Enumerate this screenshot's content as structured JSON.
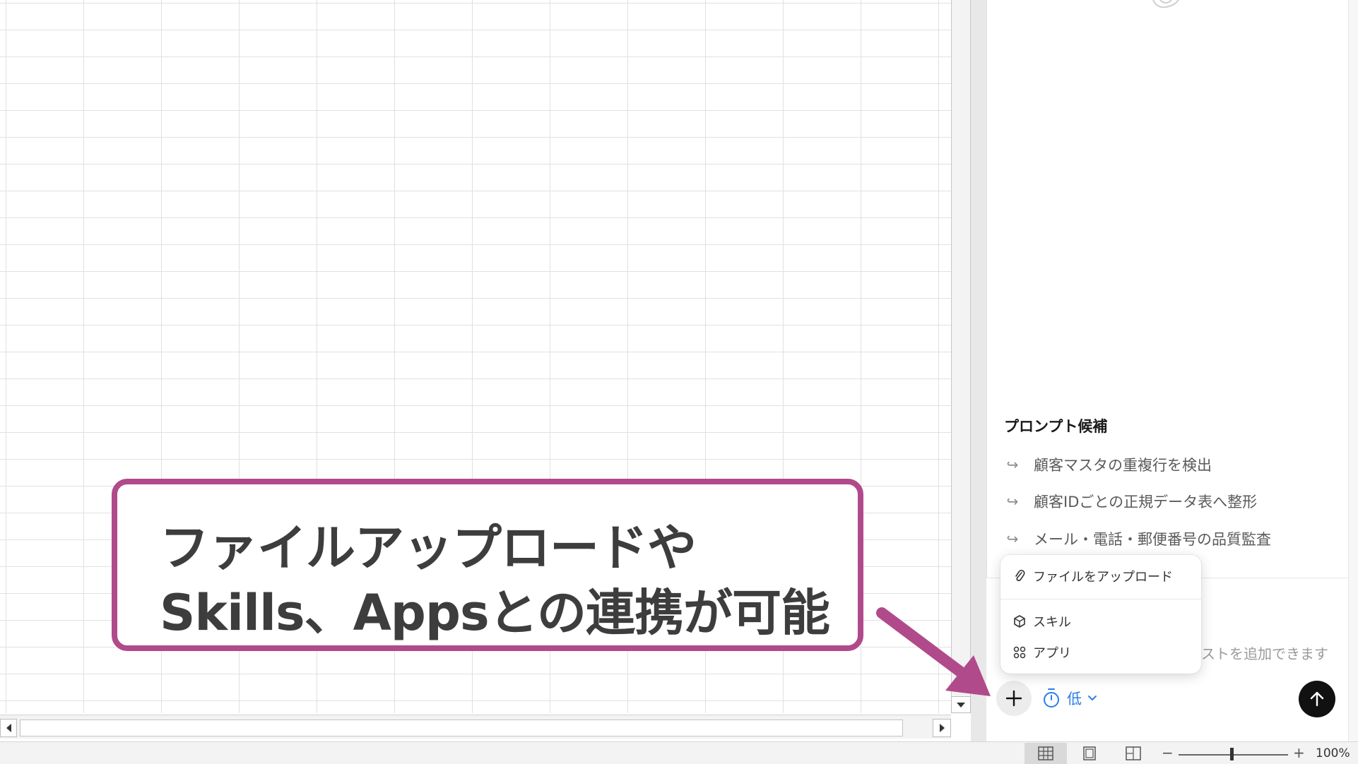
{
  "colors": {
    "callout_border": "#b04a8b",
    "arrow": "#b04a8b",
    "effort_accent": "#2b7de9",
    "send_button": "#111111"
  },
  "callout": {
    "line1": "ファイルアップロードや",
    "line2": "Skills、Appsとの連携が可能"
  },
  "panel": {
    "suggestions_title": "プロンプト候補",
    "suggestions": [
      "顧客マスタの重複行を検出",
      "顧客IDごとの正規データ表へ整形",
      "メール・電話・郵便番号の品質監査"
    ],
    "composer_placeholder": "ストを追加できます。",
    "effort_label": "低"
  },
  "menu": {
    "upload": "ファイルをアップロード",
    "skills": "スキル",
    "apps": "アプリ"
  },
  "statusbar": {
    "zoom_minus": "−",
    "zoom_plus": "+",
    "zoom_level": "100%"
  }
}
